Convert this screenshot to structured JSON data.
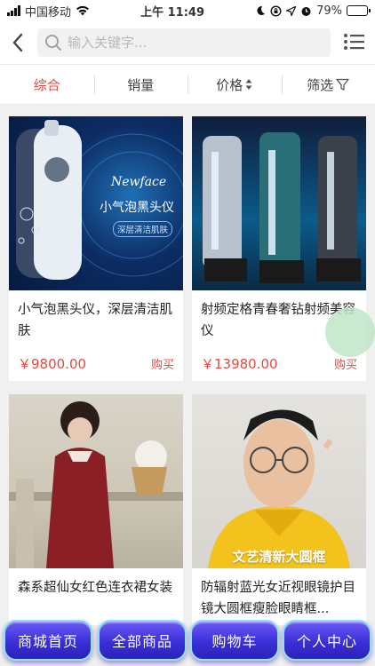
{
  "status_bar": {
    "carrier": "中国移动",
    "time": "上午 11:49",
    "battery": "79%",
    "battery_level": 0.79
  },
  "navbar": {
    "search_placeholder": "输入关键字..."
  },
  "tabs": [
    {
      "label": "综合",
      "active": true
    },
    {
      "label": "销量",
      "active": false
    },
    {
      "label": "价格",
      "active": false
    },
    {
      "label": "筛选",
      "active": false
    }
  ],
  "products": [
    {
      "title": "小气泡黑头仪，深层清洁肌肤",
      "price": "￥9800.00",
      "buy_label": "购买",
      "image_text": [
        "Newface",
        "小气泡黑头仪",
        "深层清洁肌肤"
      ]
    },
    {
      "title": "射频定格青春奢钻射频美容仪",
      "price": "￥13980.00",
      "buy_label": "购买",
      "image_text": []
    },
    {
      "title": "森系超仙女红色连衣裙女装",
      "price": "",
      "buy_label": "",
      "image_text": []
    },
    {
      "title": "防辐射蓝光女近视眼镜护目镜大圆框瘦脸眼睛框...",
      "price": "",
      "buy_label": "",
      "image_text": [
        "文艺清新大圆框"
      ]
    }
  ],
  "bottom_nav": [
    {
      "label": "商城首页"
    },
    {
      "label": "全部商品"
    },
    {
      "label": "购物车"
    },
    {
      "label": "个人中心"
    }
  ],
  "colors": {
    "accent": "#e8473d",
    "button": "#3a2fd8",
    "float_ball": "#bfe6c9"
  }
}
